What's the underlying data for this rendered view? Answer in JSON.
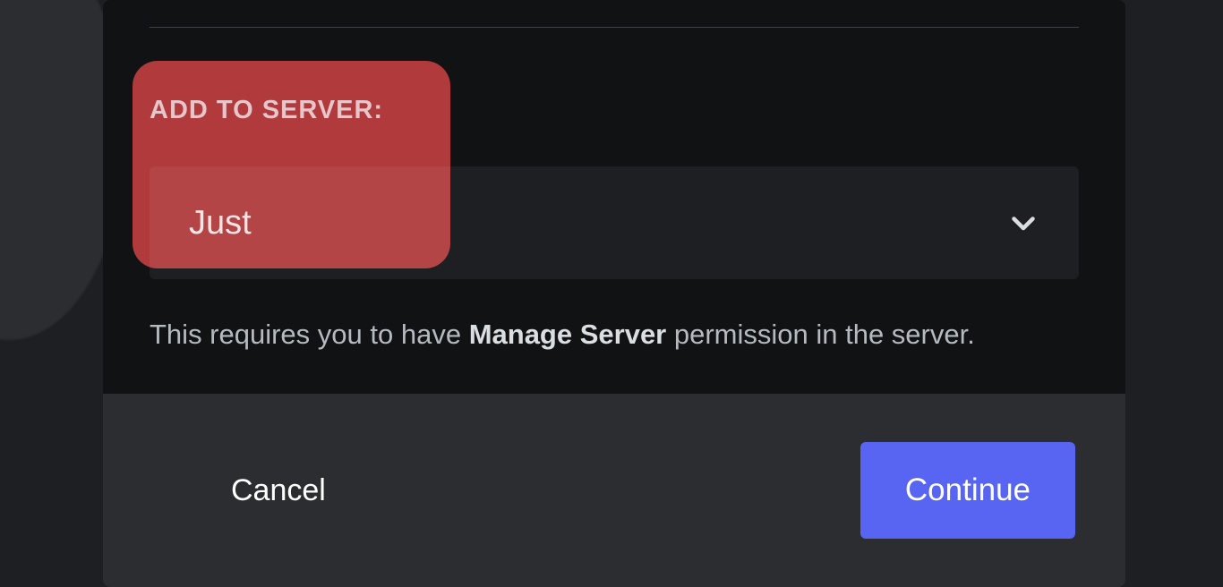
{
  "form": {
    "field_label": "ADD TO SERVER:",
    "selected_value": "Just",
    "permission_note_prefix": "This requires you to have ",
    "permission_name": "Manage Server",
    "permission_note_suffix": " permission in the server."
  },
  "footer": {
    "cancel_label": "Cancel",
    "continue_label": "Continue"
  }
}
